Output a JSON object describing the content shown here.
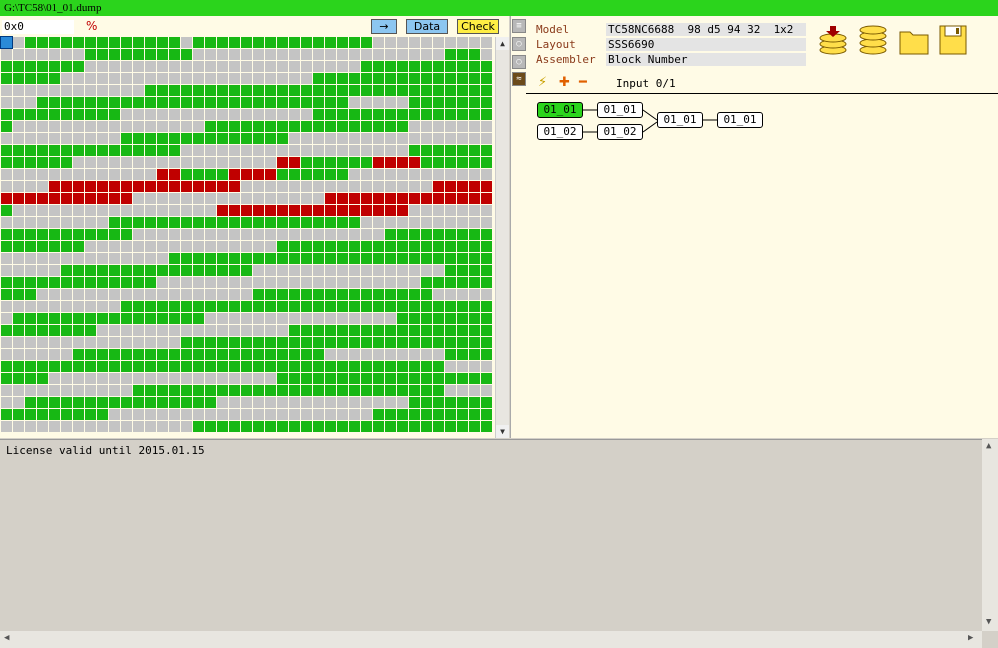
{
  "window": {
    "title": "G:\\TC58\\01_01.dump"
  },
  "toolbar": {
    "address_value": "0x0",
    "percent_icon": "percent-icon",
    "arrow_label": "→",
    "data_label": "Data",
    "check_label": "Check"
  },
  "colors": {
    "good": "#17b814",
    "empty": "#c4c4c4",
    "bad": "#c00000",
    "accent": "#2bd41c"
  },
  "dump_grid": {
    "cols": 41,
    "rows": 33,
    "row_patterns": [
      "0EGGGGGGGGGGGGGEGGGGGGGGGGGGGGGEEEEEEEEEE",
      "EEEEEEEGGGGGGGGGEEEEEEEEEEEEEEEEEEEEEGGGE",
      "GGGGGGGEEEEEEEEEEEEEEEEEEEEEEEGGGGGGGGGGG",
      "GGGGGEEEEEEEEEEEEEEEEEEEEEGGGGGGGGGGGGGGG",
      "EEEEEEEEEEEEGGGGGGGGGGGGGGGGGGGGGGGGGGGGG",
      "EEEGGGGGGGGGGGGGGGGGGGGGGGGGGEEEEEGGGGGGG",
      "GGGGGGGGGGEEEEEEEEEEEEEEEEGGGGGGGGGGGGGGG",
      "GEEEEEEEEEEEEEEEEGGGGGGGGGGGGGGGGGEEEEEEE",
      "EEEEEEEEEEGGGGGGGGGGGGGGEEEEEEEEEEEEEEEEE",
      "GGGGGGGGGGGGGGGEEEEEEEEEEEEEEEEEEEGGGGGGG",
      "GGGGGGEEEEEEEEEEEEEEEEEBBGGGGGGBBBBGGGGGG",
      "EEEEEEEEEEEEEBBGGGGBBBBGGGGGGEEEEEEEEEEEE",
      "EEEEBBBBBBBBBBBBBBBBEEEEEEEEEEEEEEEEBBBBB",
      "BBBBBBBBBBBEEEEEEEEEEEEEEEEBBBBBBBBBBBBBB",
      "GEEEEEEEEEEEEEEEEEBBBBBBBBBBBBBBBBEEEEEEE",
      "EEEEEEEEEGGGGGGGGGGGGGGGGGGGGGEEEEEEEEEEE",
      "GGGGGGGGGGGEEEEEEEEEEEEEEEEEEEEEGGGGGGGGG",
      "GGGGGGGEEEEEEEEEEEEEEEEGGGGGGGGGGGGGGGGGG",
      "EEEEEEEEEEEEEEGGGGGGGGGGGGGGGGGGGGGGGGGGG",
      "EEEEEGGGGGGGGGGGGGGGGEEEEEEEEEEEEEEEEGGGG",
      "GGGGGGGGGGGGGEEEEEEEEEEEEEEEEEEEEEEGGGGGG",
      "GGGEEEEEEEEEEEEEEEEEEGGGGGGGGGGGGGGGEEEEE",
      "EEEEEEEEEEGGGGGGGGGGGGGGGGGGGGGGGGGGGGGGG",
      "EGGGGGGGGGGGGGGGGEEEEEEEEEEEEEEEEGGGGGGGG",
      "GGGGGGGGEEEEEEEEEEEEEEEEGGGGGGGGGGGGGGGGG",
      "EEEEEEEEEEEEEEEGGGGGGGGGGGGGGGGGGGGGGGGGG",
      "EEEEEEGGGGGGGGGGGGGGGGGGGGGEEEEEEEEEEGGGG",
      "GGGGGGGGGGGGGGGGGGGGGGGGGGGGGGGGGGGGGEEEE",
      "GGGGEEEEEEEEEEEEEEEEEEEGGGGGGGGGGGGGGGGGG",
      "EEEEEEEEEEEGGGGGGGGGGGGGGGGGGGGGGGGGGEEEE",
      "EEGGGGGGGGGGGGGGGGEEEEEEEEEEEEEEEEGGGGGGG",
      "GGGGGGGGGEEEEEEEEEEEEEEEEEEEEEEGGGGGGGGGG",
      "EEEEEEEEEEEEEEEEGGGGGGGGGGGGGGGGGGGGGGGGG"
    ]
  },
  "side_icons": [
    "list-icon",
    "bulb-icon",
    "bulb-off-icon",
    "diagram-icon"
  ],
  "info": {
    "model_label": "Model",
    "model_value": "TC58NC6688  98 d5 94 32  1x2",
    "layout_label": "Layout",
    "layout_value": "SSS6690",
    "assembler_label": "Assembler",
    "assembler_value": "Block Number"
  },
  "tools": [
    "stack-download-icon",
    "stack-icon",
    "folder-icon",
    "save-icon"
  ],
  "assembler_toolbar": {
    "input_label": "Input 0/1"
  },
  "nodes": [
    {
      "label": "01_01",
      "active": true
    },
    {
      "label": "01_02",
      "active": false
    },
    {
      "label": "01_01",
      "active": false
    },
    {
      "label": "01_02",
      "active": false
    },
    {
      "label": "01_01",
      "active": false
    },
    {
      "label": "01_01",
      "active": false
    }
  ],
  "log": {
    "line1": "License valid until 2015.01.15"
  }
}
